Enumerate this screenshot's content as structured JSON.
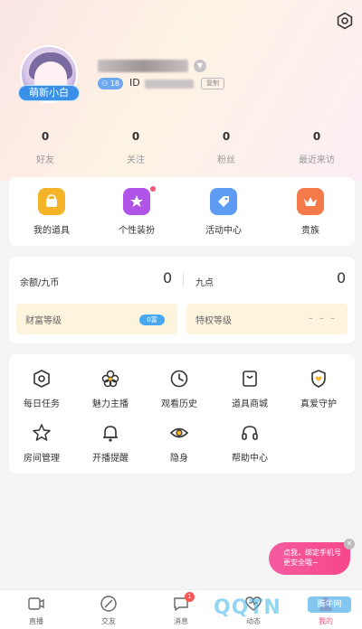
{
  "profile": {
    "avatar_badge": "萌新小白",
    "level": "18",
    "id_label": "ID",
    "copy_label": "复制"
  },
  "stats": [
    {
      "value": "0",
      "label": "好友"
    },
    {
      "value": "0",
      "label": "关注"
    },
    {
      "value": "0",
      "label": "粉丝"
    },
    {
      "value": "0",
      "label": "最近来访"
    }
  ],
  "tools": [
    {
      "label": "我的道具",
      "icon": "prop-icon",
      "color": "#f5b428"
    },
    {
      "label": "个性装扮",
      "icon": "dressup-icon",
      "color": "#b054e8"
    },
    {
      "label": "活动中心",
      "icon": "event-icon",
      "color": "#5d9cf2"
    },
    {
      "label": "贵族",
      "icon": "crown-icon",
      "color": "#f57a4a"
    }
  ],
  "wallet": {
    "balance_label": "余额/九币",
    "balance_value": "0",
    "points_label": "九点",
    "points_value": "0",
    "wealth_label": "财富等级",
    "wealth_level": "0富",
    "privilege_label": "特权等级",
    "privilege_value": "– – –"
  },
  "services": [
    {
      "label": "每日任务",
      "icon": "task-icon"
    },
    {
      "label": "魅力主播",
      "icon": "flower-icon"
    },
    {
      "label": "观看历史",
      "icon": "clock-icon"
    },
    {
      "label": "道具商城",
      "icon": "shop-icon"
    },
    {
      "label": "真爱守护",
      "icon": "shield-heart-icon"
    },
    {
      "label": "房间管理",
      "icon": "star-icon"
    },
    {
      "label": "开播提醒",
      "icon": "bell-icon"
    },
    {
      "label": "隐身",
      "icon": "eye-icon"
    },
    {
      "label": "帮助中心",
      "icon": "headset-icon"
    }
  ],
  "promo": {
    "text": "点我，绑定手机号更安全哦~"
  },
  "tabbar": [
    {
      "label": "直播",
      "icon": "live-icon"
    },
    {
      "label": "交友",
      "icon": "friends-icon"
    },
    {
      "label": "消息",
      "icon": "message-icon",
      "badge": "1"
    },
    {
      "label": "动态",
      "icon": "heartbeat-icon"
    },
    {
      "label": "我的",
      "icon": "mine-icon",
      "active": true
    }
  ],
  "watermark": {
    "text": "QQTN",
    "sub": "腾牛网"
  }
}
